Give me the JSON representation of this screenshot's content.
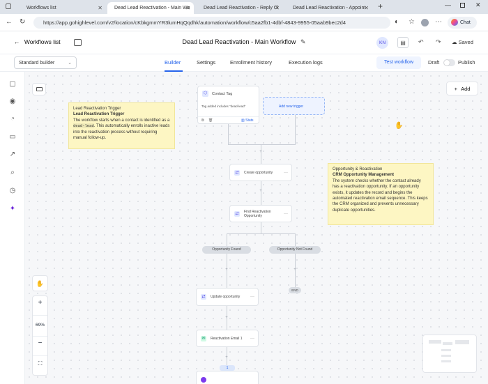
{
  "browser": {
    "tabs": [
      {
        "title": "Workflows list"
      },
      {
        "title": "Dead Lead Reactivation - Main Wo"
      },
      {
        "title": "Dead Lead Reactivation - Reply Cl"
      },
      {
        "title": "Dead Lead Reactivation - Appoint"
      }
    ],
    "url": "https://app.gohighlevel.com/v2/location/cKbkgmmYR3lumHqQqdhk/automation/workflow/c5aa2fb1-4dbf-4843-9955-05aab9bec2d4",
    "profile_label": "Chat"
  },
  "header": {
    "back_label": "Workflows list",
    "title": "Dead Lead Reactivation - Main Workflow",
    "avatar_initials": "KN",
    "saved_label": "Saved"
  },
  "subheader": {
    "builder_select": "Standard builder",
    "tabs": [
      "Builder",
      "Settings",
      "Enrollment history",
      "Execution logs"
    ],
    "test_label": "Test workflow",
    "draft_label": "Draft",
    "publish_label": "Publish"
  },
  "canvas": {
    "add_label": "Add",
    "zoom": "69%",
    "trigger": {
      "title": "Contact Tag",
      "detail": "Tag added includes \"dead-lead\"",
      "stats_label": "Stats"
    },
    "add_trigger_label": "Add new trigger",
    "steps": {
      "create": "Create opportunity",
      "find": "Find Reactivation Opportunity",
      "update": "Update opportunity",
      "email": "Reactivation Email 1"
    },
    "branches": {
      "found": "Opportunity Found",
      "not_found": "Opportunity Not Found",
      "end": "END"
    },
    "note1": {
      "heading": "Lead Reactivation Trigger",
      "title": "Lead Reactivation Trigger",
      "body_a": "The workflow starts when a contact is identified as a ",
      "code": "dead-lead",
      "body_b": ". This automatically enrolls inactive leads into the reactivation process without requiring manual follow-up."
    },
    "note2": {
      "heading": "Opportunity & Reactivation",
      "title": "CRM Opportunity Management",
      "body": "The system checks whether the contact already has a reactivation opportunity. If an opportunity exists, it updates the record and begins the automated reactivation email sequence. This keeps the CRM organized and prevents unnecessary duplicate opportunities."
    },
    "wait_badge": "1"
  },
  "colors": {
    "accent": "#2563eb",
    "note": "#fdf6c3"
  }
}
